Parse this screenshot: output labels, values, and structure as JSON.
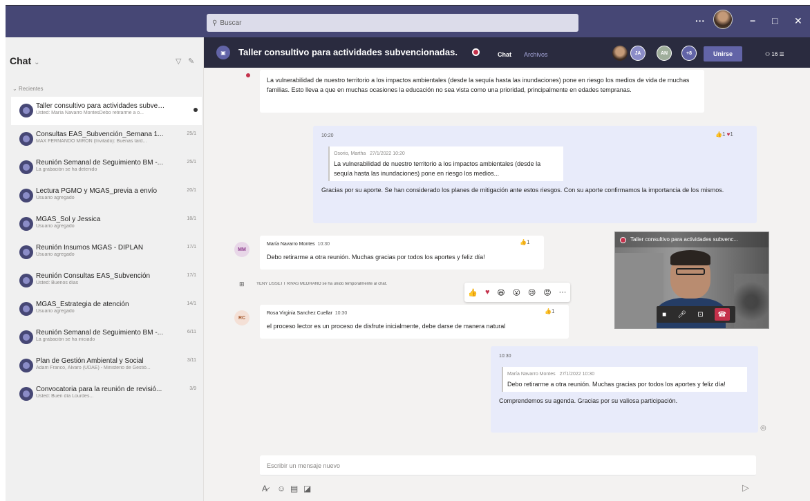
{
  "search": {
    "placeholder": "Buscar"
  },
  "window_controls": {
    "more": "···",
    "minimize": "−",
    "maximize": "□",
    "close": "✕"
  },
  "sidebar": {
    "title": "Chat",
    "section": "Recientes",
    "items": [
      {
        "name": "Taller consultivo para actividades subvenc...",
        "preview": "Usted: María Navarro MontesDebo retirarme a o...",
        "date": "",
        "active": true
      },
      {
        "name": "Consultas EAS_Subvención_Semana 1...",
        "preview": "MAX FERNANDO MIRÓN (Invitado): Buenas tard...",
        "date": "25/1"
      },
      {
        "name": "Reunión Semanal de Seguimiento BM -...",
        "preview": "La grabación se ha detenido",
        "date": "25/1"
      },
      {
        "name": "Lectura PGMO y MGAS_previa a envío",
        "preview": "Usuario agregado",
        "date": "20/1"
      },
      {
        "name": "MGAS_Sol y Jessica",
        "preview": "Usuario agregado",
        "date": "18/1"
      },
      {
        "name": "Reunión Insumos MGAS - DIPLAN",
        "preview": "Usuario agregado",
        "date": "17/1"
      },
      {
        "name": "Reunión Consultas EAS_Subvención",
        "preview": "Usted: Buenos días",
        "date": "17/1"
      },
      {
        "name": "MGAS_Estrategia de atención",
        "preview": "Usuario agregado",
        "date": "14/1"
      },
      {
        "name": "Reunión Semanal de Seguimiento BM -...",
        "preview": "La grabación se ha iniciado",
        "date": "6/11"
      },
      {
        "name": "Plan de Gestión Ambiental y Social",
        "preview": "Adam Franco, Álvaro (UDAE) - Ministerio de Gestió...",
        "date": "3/11"
      },
      {
        "name": "Convocatoria para la reunión de revisió...",
        "preview": "Usted: Buen día Lourdes...",
        "date": "3/9"
      }
    ]
  },
  "channel": {
    "title": "Taller consultivo para actividades subvencionadas.",
    "tabs": [
      "Chat",
      "Archivos"
    ],
    "participants": [
      "JA",
      "AN",
      "+8"
    ],
    "join_label": "Unirse",
    "people_count": "16"
  },
  "messages": {
    "m1_text": "La vulnerabilidad de nuestro territorio a los impactos ambientales (desde la sequía hasta las inundaciones) pone en riesgo los medios de vida de muchas familias. Esto lleva a que en muchas ocasiones la educación no sea vista como una prioridad, principalmente en edades tempranas.",
    "m2_time": "10:20",
    "m2_quote_author": "Osorio, Martha",
    "m2_quote_time": "27/1/2022 10:20",
    "m2_quote_text": "La vulnerabilidad de nuestro territorio a los impactos ambientales (desde la sequía hasta las inundaciones) pone en riesgo los medios...",
    "m2_text": "Gracias por su aporte. Se han considerado los planes de mitigación ante estos riesgos. Con su aporte confirmamos la importancia de los mismos.",
    "m2_reacts": "1",
    "m3_initials": "MM",
    "m3_author": "María Navarro Montes",
    "m3_time": "10:30",
    "m3_text": "Debo retirarme a otra reunión. Muchas gracias por todos los aportes y feliz día!",
    "m3_reacts": "1",
    "system_text": "YENY LISSETT RIVAS MEDRANO se ha unido temporalmente al chat.",
    "m4_initials": "RC",
    "m4_author": "Rosa Virginia Sanchez Cuellar",
    "m4_time": "10:30",
    "m4_text": "el proceso lector es un proceso de disfrute inicialmente, debe darse de manera natural",
    "m4_reacts": "1",
    "m5_time": "10:30",
    "m5_quote_author": "María Navarro Montes",
    "m5_quote_time": "27/1/2022 10:30",
    "m5_quote_text": "Debo retirarme a otra reunión. Muchas gracias por todos los aportes y feliz día!",
    "m5_text": "Comprendemos su agenda. Gracias por su valiosa participación."
  },
  "video": {
    "title": "Taller consultivo para actividades subvenc..."
  },
  "compose": {
    "placeholder": "Escribir un mensaje nuevo"
  },
  "colors": {
    "brand": "#464775",
    "accent": "#6264a7",
    "heart": "#c4314b"
  }
}
